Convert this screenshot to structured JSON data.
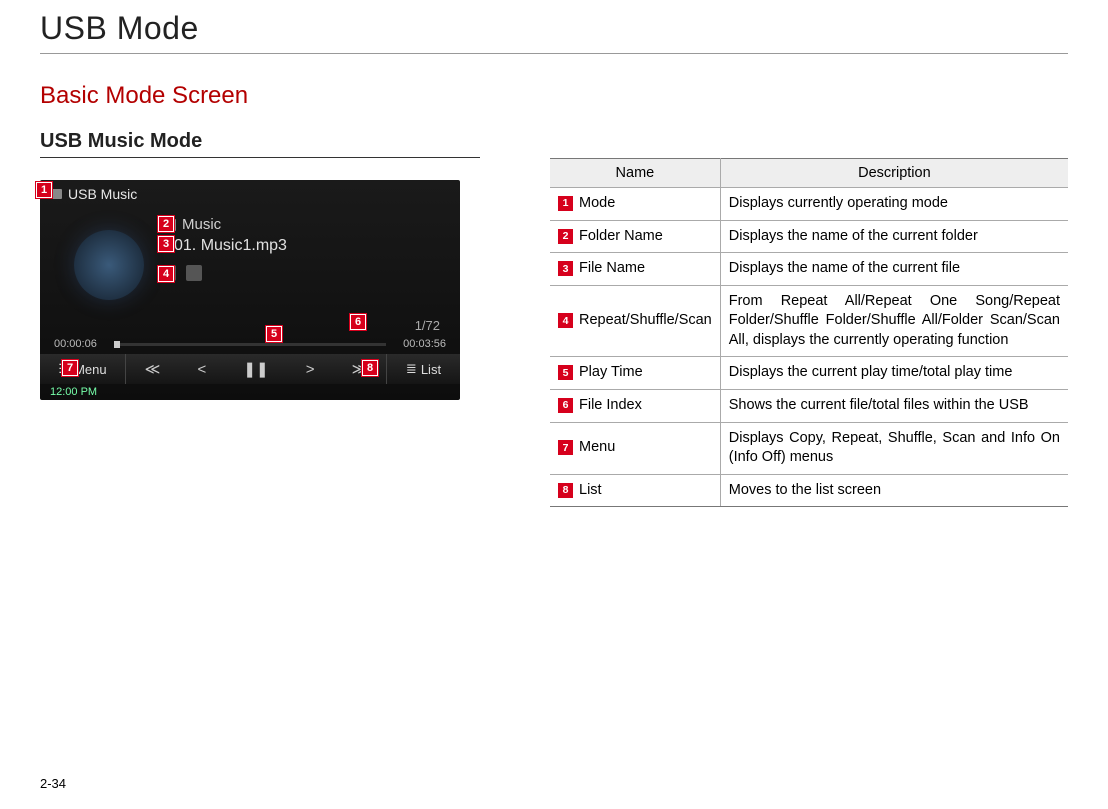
{
  "page": {
    "title": "USB Mode",
    "section_heading": "Basic Mode Screen",
    "sub_heading": "USB Music Mode",
    "page_number": "2-34"
  },
  "screenshot": {
    "mode_label": "USB  Music",
    "folder_name": "Music",
    "file_name": "01. Music1.mp3",
    "file_index": "1/72",
    "time_current": "00:00:06",
    "time_total": "00:03:56",
    "menu_label": "Menu",
    "list_label": "List",
    "clock": "12:00 PM"
  },
  "callouts": {
    "1": "1",
    "2": "2",
    "3": "3",
    "4": "4",
    "5": "5",
    "6": "6",
    "7": "7",
    "8": "8"
  },
  "table": {
    "headers": {
      "name": "Name",
      "desc": "Description"
    },
    "rows": [
      {
        "num": "1",
        "name": "Mode",
        "desc": "Displays currently operating mode"
      },
      {
        "num": "2",
        "name": "Folder Name",
        "desc": "Displays the name of the current folder"
      },
      {
        "num": "3",
        "name": "File Name",
        "desc": "Displays the name of the current file"
      },
      {
        "num": "4",
        "name": "Repeat/Shuffle/Scan",
        "desc": "From Repeat All/Repeat One Song/Repeat Folder/Shuffle Folder/Shuffle All/Folder Scan/Scan All, displays the currently operating function"
      },
      {
        "num": "5",
        "name": "Play Time",
        "desc": "Displays the current play time/total play time"
      },
      {
        "num": "6",
        "name": "File Index",
        "desc": "Shows the current file/total files within the USB"
      },
      {
        "num": "7",
        "name": "Menu",
        "desc": "Displays Copy, Repeat, Shuffle, Scan and Info On (Info Off) menus"
      },
      {
        "num": "8",
        "name": "List",
        "desc": "Moves to the list screen"
      }
    ]
  }
}
